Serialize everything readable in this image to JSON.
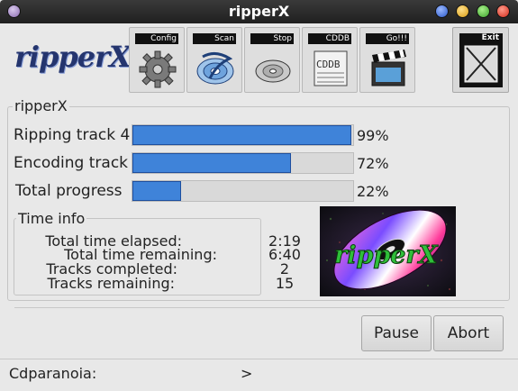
{
  "window": {
    "title": "ripperX"
  },
  "toolbar": {
    "logo_text": "ripperX",
    "buttons": [
      {
        "label": "Config",
        "icon": "gear-icon"
      },
      {
        "label": "Scan",
        "icon": "scan-disc-icon"
      },
      {
        "label": "Stop",
        "icon": "stop-disc-icon"
      },
      {
        "label": "CDDB",
        "icon": "cddb-icon"
      },
      {
        "label": "Go!!!",
        "icon": "clapperboard-icon"
      }
    ],
    "exit_label": "Exit"
  },
  "progress_group": {
    "title": "ripperX",
    "rows": [
      {
        "label": "Ripping track 4",
        "value": 99,
        "text": "99%"
      },
      {
        "label": "Encoding track",
        "value": 72,
        "text": "72%"
      },
      {
        "label": "Total progress",
        "value": 22,
        "text": "22%"
      }
    ]
  },
  "time_info": {
    "title": "Time info",
    "rows": [
      {
        "label": "Total time elapsed:",
        "value": "2:19"
      },
      {
        "label": "Total time remaining:",
        "value": "6:40"
      },
      {
        "label": "Tracks completed:",
        "value": "2"
      },
      {
        "label": "Tracks remaining:",
        "value": "15"
      }
    ]
  },
  "banner": {
    "text": "ripperX"
  },
  "actions": {
    "pause_label": "Pause",
    "abort_label": "Abort"
  },
  "status": {
    "key": "Cdparanoia:",
    "value": ">"
  },
  "colors": {
    "progress_fill": "#3f83d9",
    "titlebar": "#2a2a2a",
    "banner_green": "#2fbf3a"
  }
}
